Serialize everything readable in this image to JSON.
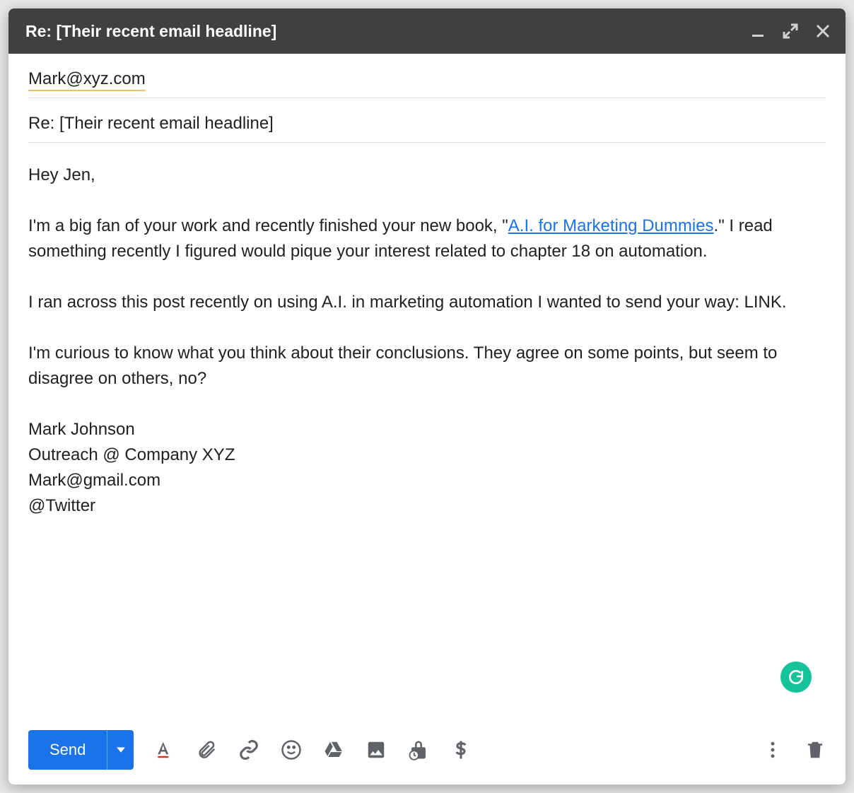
{
  "titlebar": {
    "title": "Re: [Their recent email headline]"
  },
  "fields": {
    "to": "Mark@xyz.com",
    "subject": "Re: [Their recent email headline]"
  },
  "body": {
    "greeting": "Hey Jen,",
    "p1_before_link": "I'm a big fan of your work and recently finished your new book, \"",
    "p1_link": "A.I. for Marketing Dummies",
    "p1_after_link": ".\" I read something recently I figured would pique your interest related to chapter 18 on automation.",
    "p2": "I ran across this post recently on using A.I. in marketing automation I wanted to send your way: LINK.",
    "p3": "I'm curious to know what you think about their conclusions. They agree on some points, but seem to disagree on others, no?",
    "sig_name": "Mark Johnson",
    "sig_role": "Outreach @ Company XYZ",
    "sig_email": "Mark@gmail.com",
    "sig_twitter": "@Twitter"
  },
  "toolbar": {
    "send_label": "Send"
  },
  "icons": {
    "minimize": "minimize-icon",
    "expand": "expand-icon",
    "close": "close-icon",
    "format": "format-text-icon",
    "attach": "paperclip-icon",
    "link": "link-icon",
    "emoji": "emoji-icon",
    "drive": "drive-icon",
    "photo": "photo-icon",
    "confidential": "lock-clock-icon",
    "money": "dollar-icon",
    "more": "more-vert-icon",
    "trash": "trash-icon",
    "grammarly": "grammarly-icon"
  }
}
